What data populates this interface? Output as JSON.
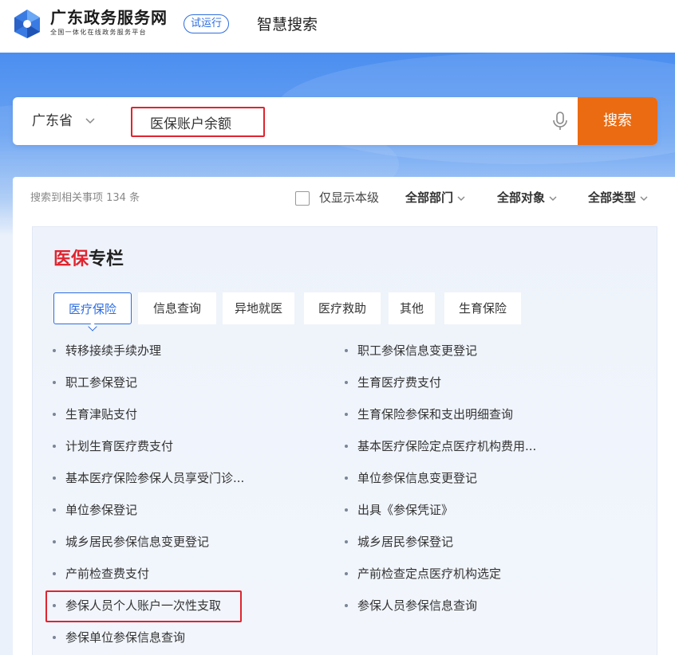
{
  "header": {
    "site_title": "广东政务服务网",
    "site_subtitle": "全国一体化在线政务服务平台",
    "trial_badge": "试运行",
    "page_heading": "智慧搜索"
  },
  "search": {
    "region": "广东省",
    "query": "医保账户余额",
    "button_label": "搜索"
  },
  "results": {
    "count_text": "搜索到相关事项 134 条",
    "filters": {
      "only_this_level": "仅显示本级",
      "department": "全部部门",
      "target": "全部对象",
      "type": "全部类型"
    }
  },
  "column": {
    "title_highlight": "医保",
    "title_rest": "专栏",
    "tabs": [
      "医疗保险",
      "信息查询",
      "异地就医",
      "医疗救助",
      "其他",
      "生育保险"
    ],
    "active_tab": "医疗保险",
    "items_left": [
      "转移接续手续办理",
      "职工参保登记",
      "生育津贴支付",
      "计划生育医疗费支付",
      "基本医疗保险参保人员享受门诊...",
      "单位参保登记",
      "城乡居民参保信息变更登记",
      "产前检查费支付",
      "参保人员个人账户一次性支取",
      "参保单位参保信息查询"
    ],
    "items_right": [
      "职工参保信息变更登记",
      "生育医疗费支付",
      "生育保险参保和支出明细查询",
      "基本医疗保险定点医疗机构费用...",
      "单位参保信息变更登记",
      "出具《参保凭证》",
      "城乡居民参保登记",
      "产前检查定点医疗机构选定",
      "参保人员参保信息查询"
    ]
  },
  "colors": {
    "brand_blue": "#2d6de0",
    "search_button": "#ea6b12",
    "highlight_red": "#e0242f"
  }
}
